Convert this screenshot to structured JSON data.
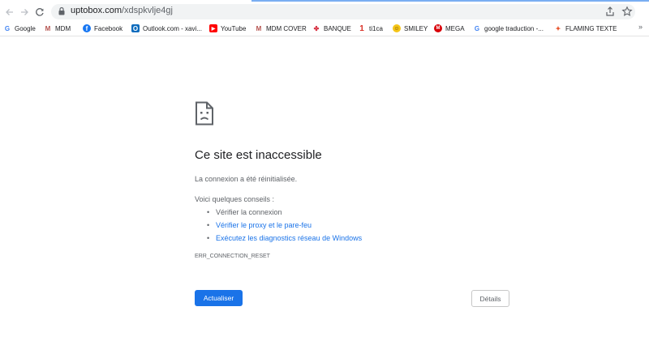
{
  "browser": {
    "url_host": "uptobox.com",
    "url_path": "/xdspkvlje4gj",
    "icons": [
      "back-icon",
      "forward-icon",
      "reload-icon",
      "lock-icon",
      "share-icon",
      "star-icon"
    ]
  },
  "bookmarks": [
    {
      "label": "Google",
      "icon": "google-icon",
      "color": "#4285f4"
    },
    {
      "label": "MDM",
      "icon": "mdm-icon",
      "color": "#b5524e"
    },
    {
      "label": "Facebook",
      "icon": "facebook-icon",
      "color": "#1877f2"
    },
    {
      "label": "Outlook.com - xavi...",
      "icon": "outlook-icon",
      "color": "#0f6cbd"
    },
    {
      "label": "YouTube",
      "icon": "youtube-icon",
      "color": "#ff0000"
    },
    {
      "label": "MDM COVER",
      "icon": "mdm-cover-icon",
      "color": "#b5524e"
    },
    {
      "label": "BANQUE",
      "icon": "banque-icon",
      "color": "#d62e3f"
    },
    {
      "label": "ti1ca",
      "icon": "ti1ca-icon",
      "color": "#d93025"
    },
    {
      "label": "SMILEY",
      "icon": "smiley-icon",
      "color": "#f5c518"
    },
    {
      "label": "MEGA",
      "icon": "mega-icon",
      "color": "#d90007"
    },
    {
      "label": "google traduction -...",
      "icon": "google-icon",
      "color": "#4285f4"
    },
    {
      "label": "FLAMING TEXTE",
      "icon": "flame-icon",
      "color": "#e8542d"
    }
  ],
  "bookmarks_more": "»",
  "error": {
    "icon": "sad-page-icon",
    "title": "Ce site est inaccessible",
    "subtitle": "La connexion a été réinitialisée.",
    "tips_label": "Voici quelques conseils :",
    "tips": [
      {
        "text": "Vérifier la connexion",
        "is_link": false
      },
      {
        "text": "Vérifier le proxy et le pare-feu",
        "is_link": true
      },
      {
        "text": "Exécutez les diagnostics réseau de Windows",
        "is_link": true
      }
    ],
    "code": "ERR_CONNECTION_RESET"
  },
  "buttons": {
    "reload": "Actualiser",
    "details": "Détails"
  },
  "colors": {
    "primary": "#1a73e8",
    "text": "#202124",
    "secondary_text": "#5f6368"
  }
}
